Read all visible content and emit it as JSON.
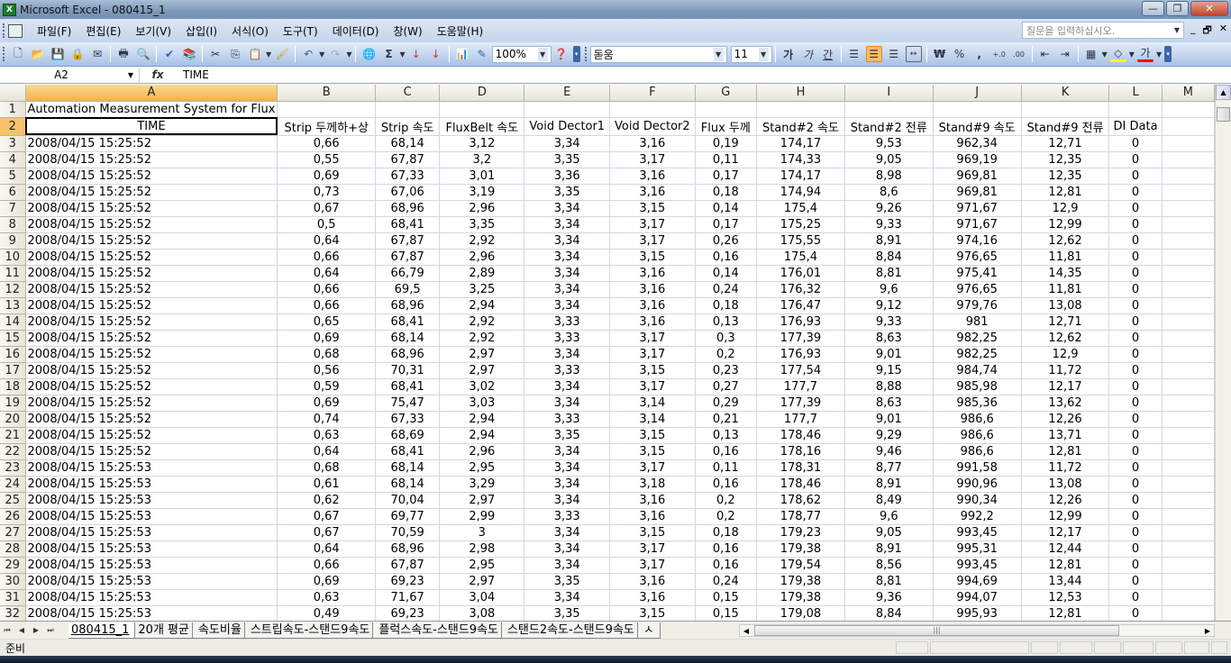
{
  "window": {
    "title": "Microsoft Excel - 080415_1",
    "app_icon": "excel-icon",
    "buttons": {
      "minimize": "—",
      "restore": "❐",
      "close": "✕"
    }
  },
  "menubar": {
    "items": [
      "파일(F)",
      "편집(E)",
      "보기(V)",
      "삽입(I)",
      "서식(O)",
      "도구(T)",
      "데이터(D)",
      "창(W)",
      "도움말(H)"
    ],
    "help_placeholder": "질문을 입력하십시오.",
    "doc_buttons": {
      "minimize": "_",
      "restore": "🗗",
      "close": "✕"
    }
  },
  "toolbar": {
    "standard_icons": [
      "new-icon",
      "open-icon",
      "save-icon",
      "permission-icon",
      "email-icon",
      "print-icon",
      "print-preview-icon",
      "spelling-icon",
      "research-icon",
      "cut-icon",
      "copy-icon",
      "paste-icon",
      "format-painter-icon",
      "undo-icon",
      "redo-icon",
      "hyperlink-icon",
      "autosum-icon",
      "sort-ascending-icon",
      "sort-descending-icon",
      "chart-wizard-icon",
      "drawing-icon",
      "help-icon"
    ],
    "zoom": "100%",
    "font_name": "돋움",
    "font_size": "11",
    "bold": "가",
    "italic": "가",
    "underline": "간",
    "currency": "₩",
    "percent": "%",
    "comma": ",",
    "increase_decimal": "+.0",
    "decrease_decimal": ".00",
    "font_color_label": "가",
    "colors": {
      "fill": "#ffff00",
      "font": "#ff0000",
      "active_align": "#ffbd69"
    }
  },
  "formula_bar": {
    "name_box": "A2",
    "fx": "fx",
    "content": "TIME"
  },
  "sheet": {
    "columns": [
      "A",
      "B",
      "C",
      "D",
      "E",
      "F",
      "G",
      "H",
      "I",
      "J",
      "K",
      "L",
      "M"
    ],
    "selected_cell": "A2",
    "row1_title": "Automation Measurement System for Flux",
    "headers": [
      "TIME",
      "Strip 두께하+상",
      "Strip 속도",
      "FluxBelt 속도",
      "Void Dector1",
      "Void Dector2",
      "Flux 두께",
      "Stand#2 속도",
      "Stand#2 전류",
      "Stand#9 속도",
      "Stand#9 전류",
      "DI Data"
    ],
    "rows": [
      [
        "2008/04/15 15:25:52",
        "0,66",
        "68,14",
        "3,12",
        "3,34",
        "3,16",
        "0,19",
        "174,17",
        "9,53",
        "962,34",
        "12,71",
        "0"
      ],
      [
        "2008/04/15 15:25:52",
        "0,55",
        "67,87",
        "3,2",
        "3,35",
        "3,17",
        "0,11",
        "174,33",
        "9,05",
        "969,19",
        "12,35",
        "0"
      ],
      [
        "2008/04/15 15:25:52",
        "0,69",
        "67,33",
        "3,01",
        "3,36",
        "3,16",
        "0,17",
        "174,17",
        "8,98",
        "969,81",
        "12,35",
        "0"
      ],
      [
        "2008/04/15 15:25:52",
        "0,73",
        "67,06",
        "3,19",
        "3,35",
        "3,16",
        "0,18",
        "174,94",
        "8,6",
        "969,81",
        "12,81",
        "0"
      ],
      [
        "2008/04/15 15:25:52",
        "0,67",
        "68,96",
        "2,96",
        "3,34",
        "3,15",
        "0,14",
        "175,4",
        "9,26",
        "971,67",
        "12,9",
        "0"
      ],
      [
        "2008/04/15 15:25:52",
        "0,5",
        "68,41",
        "3,35",
        "3,34",
        "3,17",
        "0,17",
        "175,25",
        "9,33",
        "971,67",
        "12,99",
        "0"
      ],
      [
        "2008/04/15 15:25:52",
        "0,64",
        "67,87",
        "2,92",
        "3,34",
        "3,17",
        "0,26",
        "175,55",
        "8,91",
        "974,16",
        "12,62",
        "0"
      ],
      [
        "2008/04/15 15:25:52",
        "0,66",
        "67,87",
        "2,96",
        "3,34",
        "3,15",
        "0,16",
        "175,4",
        "8,84",
        "976,65",
        "11,81",
        "0"
      ],
      [
        "2008/04/15 15:25:52",
        "0,64",
        "66,79",
        "2,89",
        "3,34",
        "3,16",
        "0,14",
        "176,01",
        "8,81",
        "975,41",
        "14,35",
        "0"
      ],
      [
        "2008/04/15 15:25:52",
        "0,66",
        "69,5",
        "3,25",
        "3,34",
        "3,16",
        "0,24",
        "176,32",
        "9,6",
        "976,65",
        "11,81",
        "0"
      ],
      [
        "2008/04/15 15:25:52",
        "0,66",
        "68,96",
        "2,94",
        "3,34",
        "3,16",
        "0,18",
        "176,47",
        "9,12",
        "979,76",
        "13,08",
        "0"
      ],
      [
        "2008/04/15 15:25:52",
        "0,65",
        "68,41",
        "2,92",
        "3,33",
        "3,16",
        "0,13",
        "176,93",
        "9,33",
        "981",
        "12,71",
        "0"
      ],
      [
        "2008/04/15 15:25:52",
        "0,69",
        "68,14",
        "2,92",
        "3,33",
        "3,17",
        "0,3",
        "177,39",
        "8,63",
        "982,25",
        "12,62",
        "0"
      ],
      [
        "2008/04/15 15:25:52",
        "0,68",
        "68,96",
        "2,97",
        "3,34",
        "3,17",
        "0,2",
        "176,93",
        "9,01",
        "982,25",
        "12,9",
        "0"
      ],
      [
        "2008/04/15 15:25:52",
        "0,56",
        "70,31",
        "2,97",
        "3,33",
        "3,15",
        "0,23",
        "177,54",
        "9,15",
        "984,74",
        "11,72",
        "0"
      ],
      [
        "2008/04/15 15:25:52",
        "0,59",
        "68,41",
        "3,02",
        "3,34",
        "3,17",
        "0,27",
        "177,7",
        "8,88",
        "985,98",
        "12,17",
        "0"
      ],
      [
        "2008/04/15 15:25:52",
        "0,69",
        "75,47",
        "3,03",
        "3,34",
        "3,14",
        "0,29",
        "177,39",
        "8,63",
        "985,36",
        "13,62",
        "0"
      ],
      [
        "2008/04/15 15:25:52",
        "0,74",
        "67,33",
        "2,94",
        "3,33",
        "3,14",
        "0,21",
        "177,7",
        "9,01",
        "986,6",
        "12,26",
        "0"
      ],
      [
        "2008/04/15 15:25:52",
        "0,63",
        "68,69",
        "2,94",
        "3,35",
        "3,15",
        "0,13",
        "178,46",
        "9,29",
        "986,6",
        "13,71",
        "0"
      ],
      [
        "2008/04/15 15:25:52",
        "0,64",
        "68,41",
        "2,96",
        "3,34",
        "3,15",
        "0,16",
        "178,16",
        "9,46",
        "986,6",
        "12,81",
        "0"
      ],
      [
        "2008/04/15 15:25:53",
        "0,68",
        "68,14",
        "2,95",
        "3,34",
        "3,17",
        "0,11",
        "178,31",
        "8,77",
        "991,58",
        "11,72",
        "0"
      ],
      [
        "2008/04/15 15:25:53",
        "0,61",
        "68,14",
        "3,29",
        "3,34",
        "3,18",
        "0,16",
        "178,46",
        "8,91",
        "990,96",
        "13,08",
        "0"
      ],
      [
        "2008/04/15 15:25:53",
        "0,62",
        "70,04",
        "2,97",
        "3,34",
        "3,16",
        "0,2",
        "178,62",
        "8,49",
        "990,34",
        "12,26",
        "0"
      ],
      [
        "2008/04/15 15:25:53",
        "0,67",
        "69,77",
        "2,99",
        "3,33",
        "3,16",
        "0,2",
        "178,77",
        "9,6",
        "992,2",
        "12,99",
        "0"
      ],
      [
        "2008/04/15 15:25:53",
        "0,67",
        "70,59",
        "3",
        "3,34",
        "3,15",
        "0,18",
        "179,23",
        "9,05",
        "993,45",
        "12,17",
        "0"
      ],
      [
        "2008/04/15 15:25:53",
        "0,64",
        "68,96",
        "2,98",
        "3,34",
        "3,17",
        "0,16",
        "179,38",
        "8,91",
        "995,31",
        "12,44",
        "0"
      ],
      [
        "2008/04/15 15:25:53",
        "0,66",
        "67,87",
        "2,95",
        "3,34",
        "3,17",
        "0,16",
        "179,54",
        "8,56",
        "993,45",
        "12,81",
        "0"
      ],
      [
        "2008/04/15 15:25:53",
        "0,69",
        "69,23",
        "2,97",
        "3,35",
        "3,16",
        "0,24",
        "179,38",
        "8,81",
        "994,69",
        "13,44",
        "0"
      ],
      [
        "2008/04/15 15:25:53",
        "0,63",
        "71,67",
        "3,04",
        "3,34",
        "3,16",
        "0,15",
        "179,38",
        "9,36",
        "994,07",
        "12,53",
        "0"
      ],
      [
        "2008/04/15 15:25:53",
        "0,49",
        "69,23",
        "3,08",
        "3,35",
        "3,15",
        "0,15",
        "179,08",
        "8,84",
        "995,93",
        "12,81",
        "0"
      ]
    ]
  },
  "sheet_tabs": {
    "nav": [
      "⏮",
      "◀",
      "▶",
      "⏭"
    ],
    "tabs": [
      "080415_1",
      "20개 평균",
      "속도비율",
      "스트립속도-스탠드9속도",
      "플럭스속도-스탠드9속도",
      "스탠드2속도-스탠드9속도",
      "ㅅ"
    ],
    "active": 0
  },
  "status": {
    "text": "준비"
  }
}
